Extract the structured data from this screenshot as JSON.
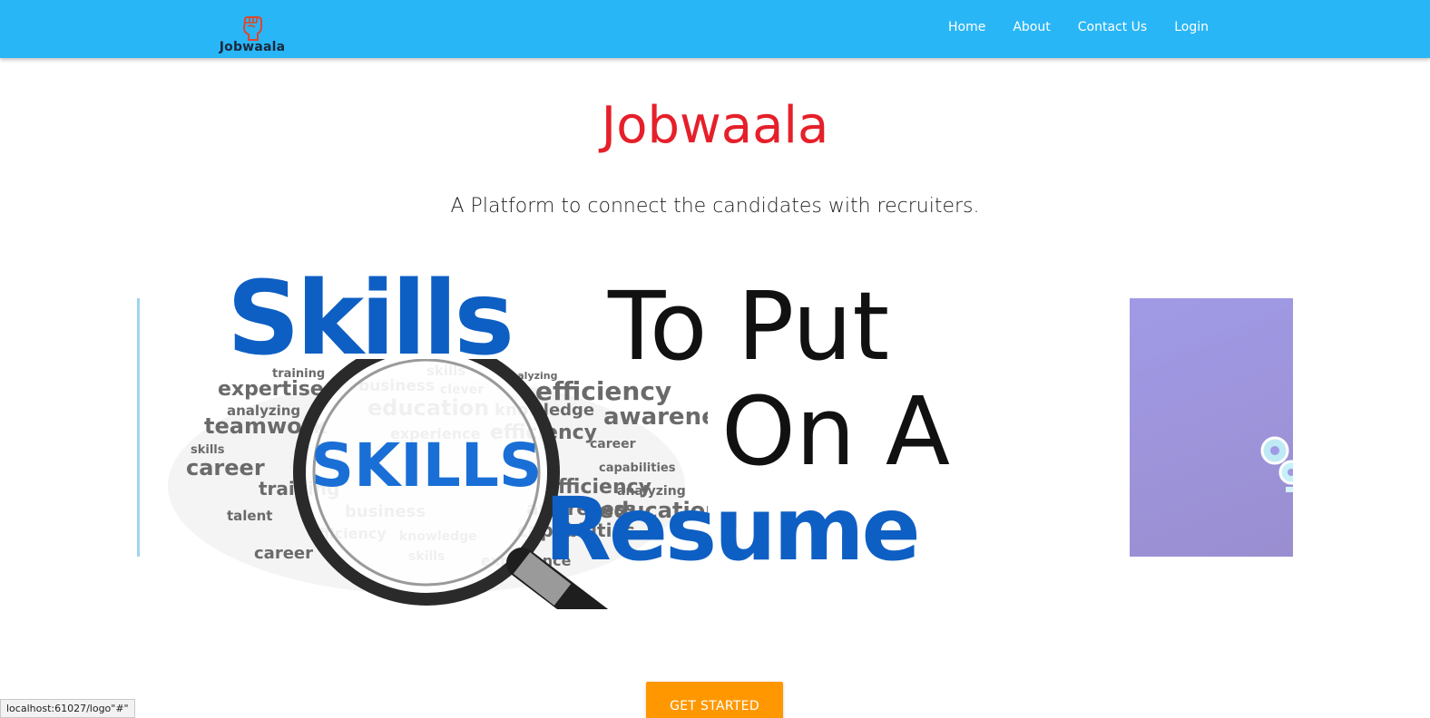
{
  "navbar": {
    "brand": {
      "label": "Jobwaala",
      "icon": "fist-logo-icon",
      "icon_color": "#e0452a"
    },
    "links": [
      {
        "label": "Home"
      },
      {
        "label": "About"
      },
      {
        "label": "Contact Us"
      },
      {
        "label": "Login"
      }
    ],
    "background": "#29b6f6"
  },
  "hero": {
    "title": "Jobwaala",
    "title_color": "#e5202a",
    "subtitle": "A Platform to connect the candidates with recruiters."
  },
  "carousel": {
    "active_slide": {
      "line1a": "Skills",
      "line1b": "To Put",
      "line2": "On A",
      "line3": "Resume",
      "magnifier_word": "SKILLS",
      "cloud_words": [
        "training",
        "skills",
        "analyzing",
        "expertise",
        "business",
        "clever",
        "efficiency",
        "analyzing",
        "education",
        "knowledge",
        "teamwork",
        "experience",
        "efficiency",
        "awareness",
        "skills",
        "career",
        "career",
        "capabilities",
        "training",
        "efficiency",
        "analyzing",
        "awareness",
        "education",
        "talent",
        "business",
        "capabilities",
        "efficiency",
        "knowledge",
        "career",
        "skills",
        "experience"
      ],
      "blue": "#0e5fc3"
    },
    "side_slide": {
      "icon": "gear-icon",
      "background": "#a09ae6"
    }
  },
  "cta": {
    "label": "GET STARTED",
    "color": "#ff9800"
  },
  "status_bar": {
    "text": "localhost:61027/logo\"#\""
  }
}
